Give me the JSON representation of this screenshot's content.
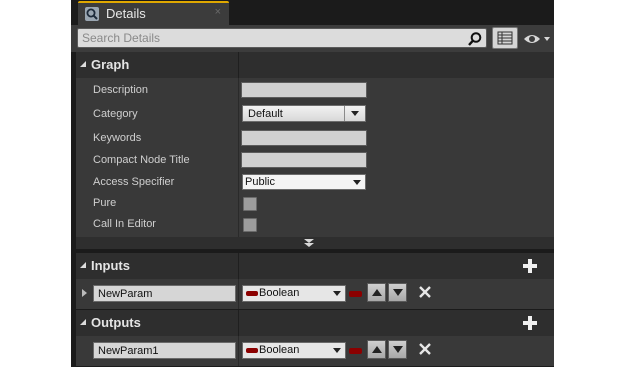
{
  "tab": {
    "title": "Details",
    "close_glyph": "×",
    "icon": "magnifier-details-icon"
  },
  "toolbar": {
    "search_placeholder": "Search Details",
    "view_icon": "view-options-icon",
    "eye_icon": "eye-icon"
  },
  "graph": {
    "title": "Graph",
    "properties": [
      {
        "label": "Description",
        "kind": "text",
        "value": ""
      },
      {
        "label": "Category",
        "kind": "combo",
        "value": "Default"
      },
      {
        "label": "Keywords",
        "kind": "text",
        "value": ""
      },
      {
        "label": "Compact Node Title",
        "kind": "text",
        "value": ""
      },
      {
        "label": "Access Specifier",
        "kind": "select",
        "value": "Public"
      },
      {
        "label": "Pure",
        "kind": "checkbox",
        "checked": false
      },
      {
        "label": "Call In Editor",
        "kind": "checkbox",
        "checked": false
      }
    ]
  },
  "inputs": {
    "title": "Inputs",
    "params": [
      {
        "name": "NewParam",
        "type": "Boolean",
        "pin_color": "#8b0000"
      }
    ]
  },
  "outputs": {
    "title": "Outputs",
    "params": [
      {
        "name": "NewParam1",
        "type": "Boolean",
        "pin_color": "#8b0000"
      }
    ]
  },
  "colors": {
    "tab_accent": "#e0a800",
    "boolean_pin": "#8b0000"
  }
}
